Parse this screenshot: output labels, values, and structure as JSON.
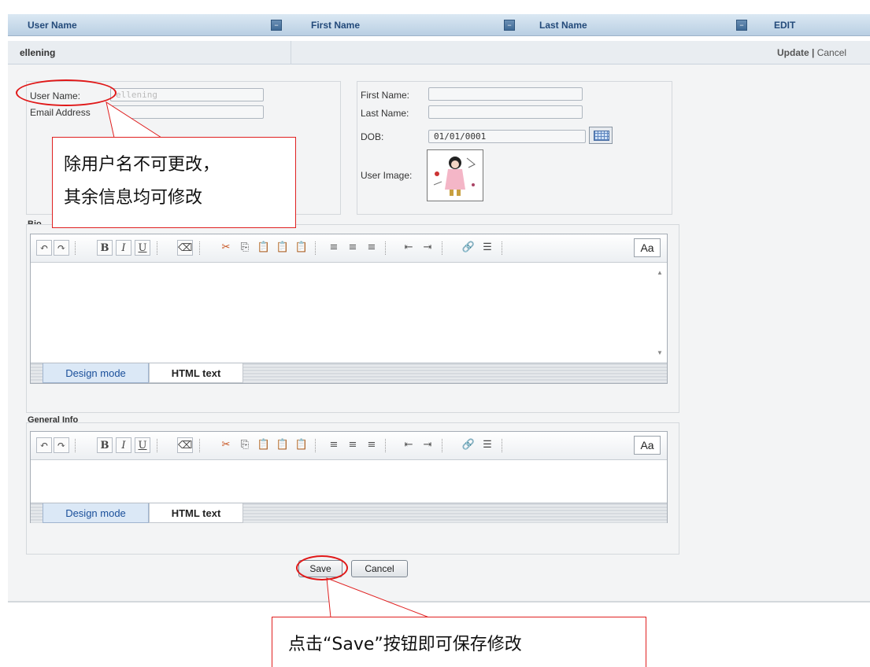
{
  "grid": {
    "headers": {
      "user_name": "User Name",
      "first_name": "First Name",
      "last_name": "Last Name",
      "edit": "EDIT"
    },
    "sort_icon": "minus-box-icon",
    "row": {
      "user_name": "ellening",
      "update": "Update",
      "divider": "|",
      "cancel": "Cancel"
    }
  },
  "form": {
    "user_name_label": "User Name:",
    "user_name_value": "ellening",
    "email_label": "Email Address",
    "email_value": "",
    "first_name_label": "First Name:",
    "first_name_value": "",
    "last_name_label": "Last Name:",
    "last_name_value": "",
    "dob_label": "DOB:",
    "dob_value": "01/01/0001",
    "user_image_label": "User Image:",
    "bio_label": "Bio",
    "general_info_label": "General Info"
  },
  "editor": {
    "toolbar_icons": [
      "undo-icon",
      "redo-icon",
      "bold-icon",
      "italic-icon",
      "underline-icon",
      "eraser-icon",
      "cut-icon",
      "copy-icon",
      "paste-icon",
      "paste-text-icon",
      "paste-word-icon",
      "align-left-icon",
      "align-center-icon",
      "align-right-icon",
      "outdent-icon",
      "indent-icon",
      "link-icon",
      "horizontal-rule-icon"
    ],
    "bold_glyph": "B",
    "italic_glyph": "I",
    "underline_glyph": "U",
    "font_button": "Aa",
    "tab_design": "Design mode",
    "tab_html": "HTML text"
  },
  "buttons": {
    "save": "Save",
    "cancel": "Cancel"
  },
  "annotations": {
    "note_line1": "除用户名不可更改，",
    "note_line2": "其余信息均可修改",
    "save_note": "点击“Save”按钮即可保存修改"
  },
  "colors": {
    "header_text": "#234a7a",
    "annotation_red": "#e02020",
    "active_tab_text": "#1a4f9a"
  }
}
